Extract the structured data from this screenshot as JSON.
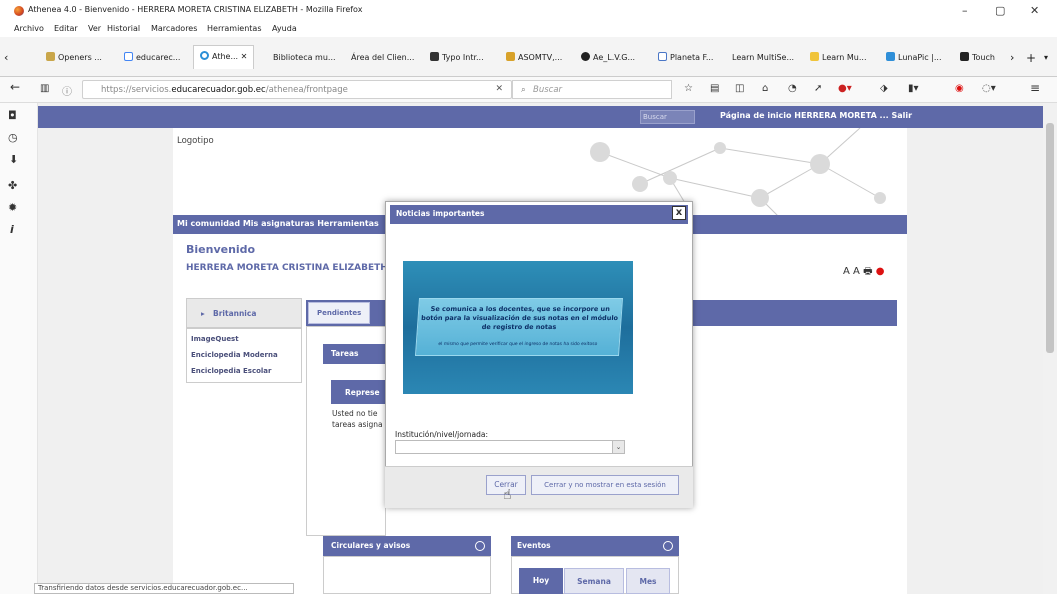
{
  "window": {
    "title": "Athenea 4.0 - Bienvenido - HERRERA MORETA CRISTINA ELIZABETH - Mozilla Firefox"
  },
  "menu": [
    "Archivo",
    "Editar",
    "Ver",
    "Historial",
    "Marcadores",
    "Herramientas",
    "Ayuda"
  ],
  "tabs": [
    {
      "label": "Openers ..."
    },
    {
      "label": "educarec..."
    },
    {
      "label": "Athe..."
    },
    {
      "label": "Biblioteca mu..."
    },
    {
      "label": "Área del Clien..."
    },
    {
      "label": "Typo Intr..."
    },
    {
      "label": "ASOMTV,..."
    },
    {
      "label": "Ae_L.V.G..."
    },
    {
      "label": "Planeta F..."
    },
    {
      "label": "Learn MultiSe..."
    },
    {
      "label": "Learn Mu..."
    },
    {
      "label": "LunaPic |..."
    },
    {
      "label": "Touch"
    }
  ],
  "address": {
    "prefix": "https://servicios.",
    "domain": "educarecuador.gob.ec",
    "path": "/athenea/frontpage",
    "search_placeholder": "Buscar"
  },
  "site": {
    "search_placeholder": "Buscar",
    "top_links": "Página de inicio   HERRERA MORETA ...   Salir",
    "logo": "Logotipo",
    "nav": "Mi comunidad   Mis asignaturas   Herramientas",
    "welcome": "Bienvenido",
    "user_name": "HERRERA MORETA CRISTINA ELIZABETH",
    "font_controls": "A A",
    "library_header": "Britannica",
    "library_items": [
      "ImageQuest",
      "Enciclopedia Moderna",
      "Enciclopedia Escolar"
    ],
    "pending_tab": "Pendientes",
    "tasks_header": "Tareas",
    "represent_header": "Represe",
    "tasks_text": "Usted no tie tareas asigna",
    "circulars_header": "Circulares y avisos",
    "events_header": "Eventos",
    "event_tabs": [
      "Hoy",
      "Semana",
      "Mes"
    ]
  },
  "modal": {
    "title": "Noticias importantes",
    "close": "x",
    "banner_text": "Se comunica a los docentes, que se incorpore un botón para la visualización de sus notas en el módulo de registro de notas",
    "banner_sub": "el mismo que permite verificar que el ingreso de notas ha sido exitoso",
    "institution_label": "Institución/nivel/jornada:",
    "institution_value": "",
    "btn_close": "Cerrar",
    "btn_close_hide": "Cerrar y no mostrar en esta sesión"
  },
  "status": "Transfiriendo datos desde servicios.educarecuador.gob.ec...",
  "colors": {
    "accent": "#5e69a8",
    "banner": "#2e8fb8"
  }
}
